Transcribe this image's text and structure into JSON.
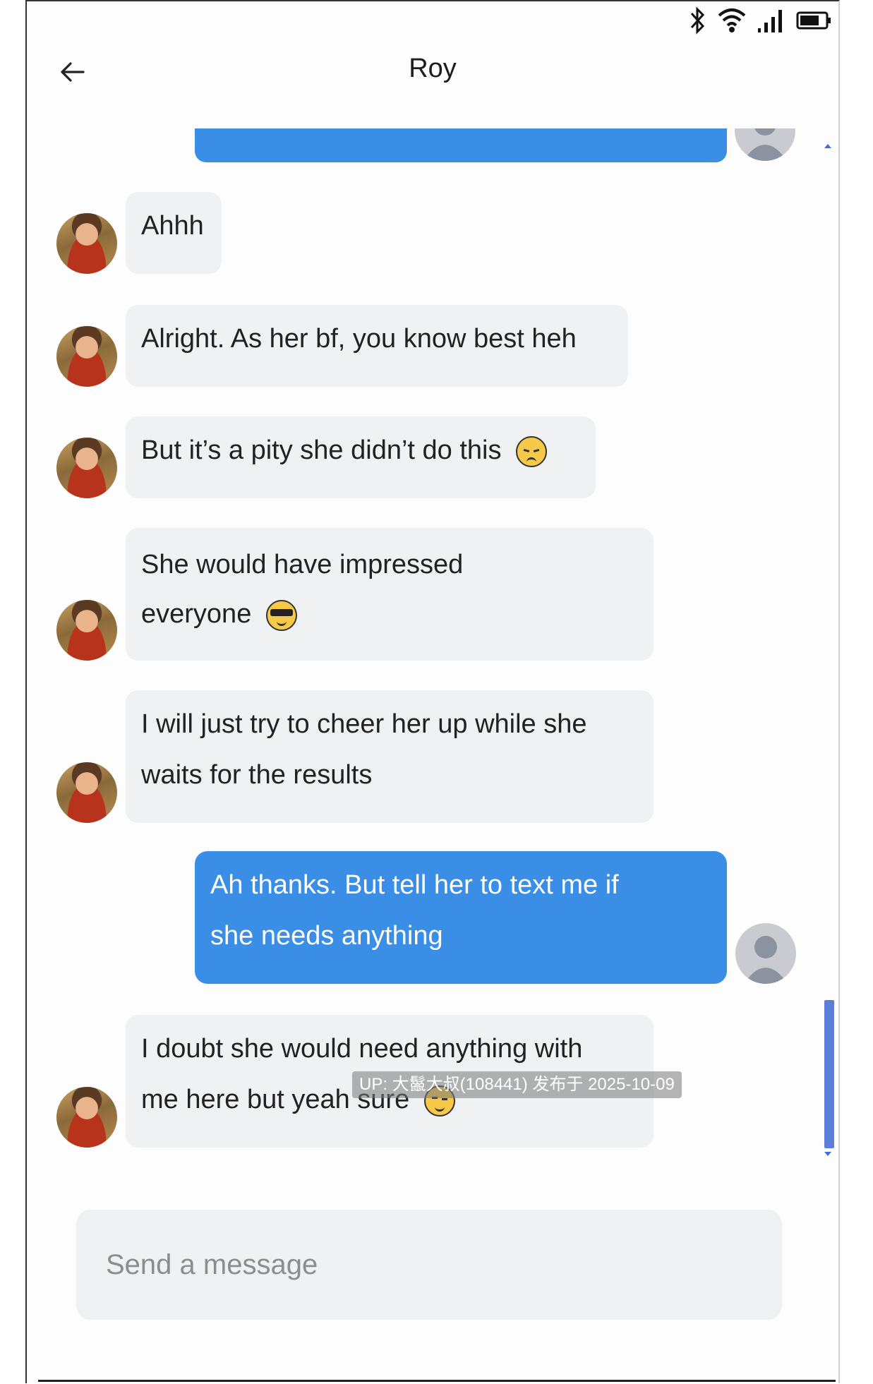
{
  "status_bar": {
    "icons": [
      "bluetooth-icon",
      "wifi-icon",
      "signal-icon",
      "battery-icon"
    ]
  },
  "header": {
    "title": "Roy",
    "back_icon": "arrow-left-icon"
  },
  "messages": [
    {
      "from": "roy",
      "lines": [
        "Ahhh"
      ]
    },
    {
      "from": "roy",
      "lines": [
        "Alright. As her bf, you know best heh"
      ]
    },
    {
      "from": "roy",
      "lines": [
        "But it’s a pity she didn’t do this"
      ],
      "emoji": "pensive-face-icon"
    },
    {
      "from": "roy",
      "lines": [
        "She would have impressed",
        "everyone"
      ],
      "emoji": "sunglasses-face-icon"
    },
    {
      "from": "roy",
      "lines": [
        "I will just try to cheer her up while she",
        "waits for the results"
      ]
    },
    {
      "from": "me",
      "lines": [
        "Ah thanks. But tell her to text me if",
        "she needs anything"
      ]
    },
    {
      "from": "roy",
      "lines": [
        "I doubt she would need anything with",
        "me here but yeah sure"
      ],
      "emoji": "wink-face-icon"
    }
  ],
  "watermark": "UP: 大鬣大叔(108441) 发布于 2025-10-09",
  "composer": {
    "placeholder": "Send a message"
  },
  "colors": {
    "outgoing_bubble": "#3a8ee6",
    "incoming_bubble": "#f0f1f3",
    "scrollbar": "#5b7fd6"
  }
}
